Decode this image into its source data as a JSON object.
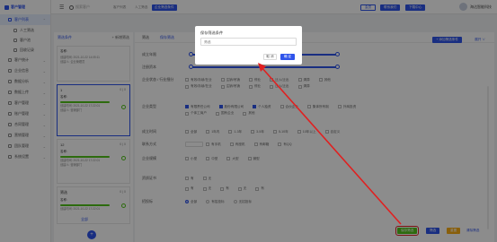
{
  "sidebar": {
    "logo": "客户管理",
    "items": [
      {
        "label": "客户列表",
        "active": true
      },
      {
        "label": "人工筛选",
        "sub": true
      },
      {
        "label": "客户池",
        "sub": true
      },
      {
        "label": "回收记录",
        "sub": true
      },
      {
        "label": "客户统计"
      },
      {
        "label": "企业信息"
      },
      {
        "label": "数据分析"
      },
      {
        "label": "数据上传"
      },
      {
        "label": "客户管理"
      },
      {
        "label": "账户管理"
      },
      {
        "label": "合同管理"
      },
      {
        "label": "营销管理"
      },
      {
        "label": "团队管理"
      },
      {
        "label": "系统设置"
      }
    ]
  },
  "topbar": {
    "search_placeholder": "搜索客户",
    "tabs": [
      "客户列表",
      "人工筛选",
      "企业筛选条件"
    ],
    "buttons": [
      "会员",
      "联系我们",
      "下载中心"
    ],
    "user": "海达智能科技"
  },
  "list_panel": {
    "title": "筛选条件",
    "link": "+ 新增筛选",
    "footer_link": "全部",
    "cards": [
      {
        "name": "",
        "meta": "",
        "field": "名称:",
        "lines": [
          "创建时间: 2021-10-22 14:05:11",
          "创建人: 企业管理员"
        ]
      },
      {
        "name": "1",
        "meta": "0 | 0",
        "field": "名称:",
        "lines": [
          "创建时间: 2021-10-22 17:22:01",
          "创建人: 营销部门"
        ],
        "selected": true
      },
      {
        "name": "12",
        "meta": "0 | 0",
        "field": "名称:",
        "lines": [
          "创建时间: 2021-10-22 17:22:01",
          "创建人: 营销部门"
        ]
      },
      {
        "name": "筛选",
        "meta": "0 | 0",
        "field": "名称:",
        "lines": [
          "创建时间: 2021-10-22 17:22:01"
        ]
      }
    ]
  },
  "main": {
    "tabs": [
      "筛选",
      "保存筛选"
    ],
    "top_button": "+ 添加筛选条件",
    "top_link": "展开 ∨",
    "rows": [
      {
        "label": "成立年限"
      },
      {
        "label": "注册资本"
      },
      {
        "label": "企业状态 / 行业细分",
        "options": [
          "有效/存续/在业",
          "注销/吊销",
          "停业",
          "迁入/迁出",
          "清算",
          "其他"
        ]
      },
      {
        "label": "",
        "options": [
          "有效/存续/在业",
          "注销/吊销",
          "停业",
          "迁入/迁出",
          "清算"
        ]
      },
      {
        "label": "企业类型",
        "options": [
          "有限责任公司",
          "股份有限公司",
          "个人独资",
          "合伙企业",
          "集体所有制",
          "外商投资"
        ]
      },
      {
        "label": "",
        "options": [
          "个体工商户",
          "国有企业",
          "其他"
        ]
      },
      {
        "label": "成立时间",
        "options": [
          "全部",
          "1年内",
          "1-3年",
          "3-5年",
          "5-10年",
          "10年以上",
          "自定义"
        ]
      },
      {
        "label": "联系方式",
        "options": [
          "有手机",
          "有座机",
          "有邮箱",
          "有QQ"
        ]
      },
      {
        "label": "企业规模",
        "options": [
          "小型",
          "中型",
          "大型",
          "微型"
        ]
      },
      {
        "label": "资质证书",
        "options": [
          "有",
          "无"
        ]
      },
      {
        "label": "",
        "options": [
          "有",
          "无",
          "有",
          "无",
          "有"
        ]
      },
      {
        "label": "招投标",
        "options": [
          "全部",
          "有招投标",
          "无招投标"
        ]
      }
    ],
    "actions": {
      "save_filter": "保存筛选",
      "filter": "筛选",
      "reset": "重置",
      "clear": "清除筛选"
    }
  },
  "dialog": {
    "title": "保存筛选条件",
    "input_placeholder": "筛选",
    "cancel": "取 消",
    "ok": "确 定"
  },
  "colors": {
    "accent": "#2f54eb",
    "success": "#52c41a",
    "warning": "#faad14",
    "annotation": "#e02020"
  }
}
